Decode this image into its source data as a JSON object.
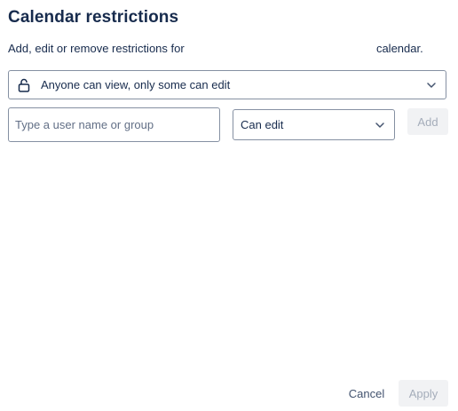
{
  "dialog": {
    "title": "Calendar restrictions",
    "description_prefix": "Add, edit or remove restrictions for",
    "description_suffix": "calendar."
  },
  "access": {
    "icon": "unlock-icon",
    "selected": "Anyone can view, only some can edit"
  },
  "add_row": {
    "user_placeholder": "Type a user name or group",
    "permission_selected": "Can edit",
    "add_label": "Add"
  },
  "footer": {
    "cancel_label": "Cancel",
    "apply_label": "Apply"
  }
}
